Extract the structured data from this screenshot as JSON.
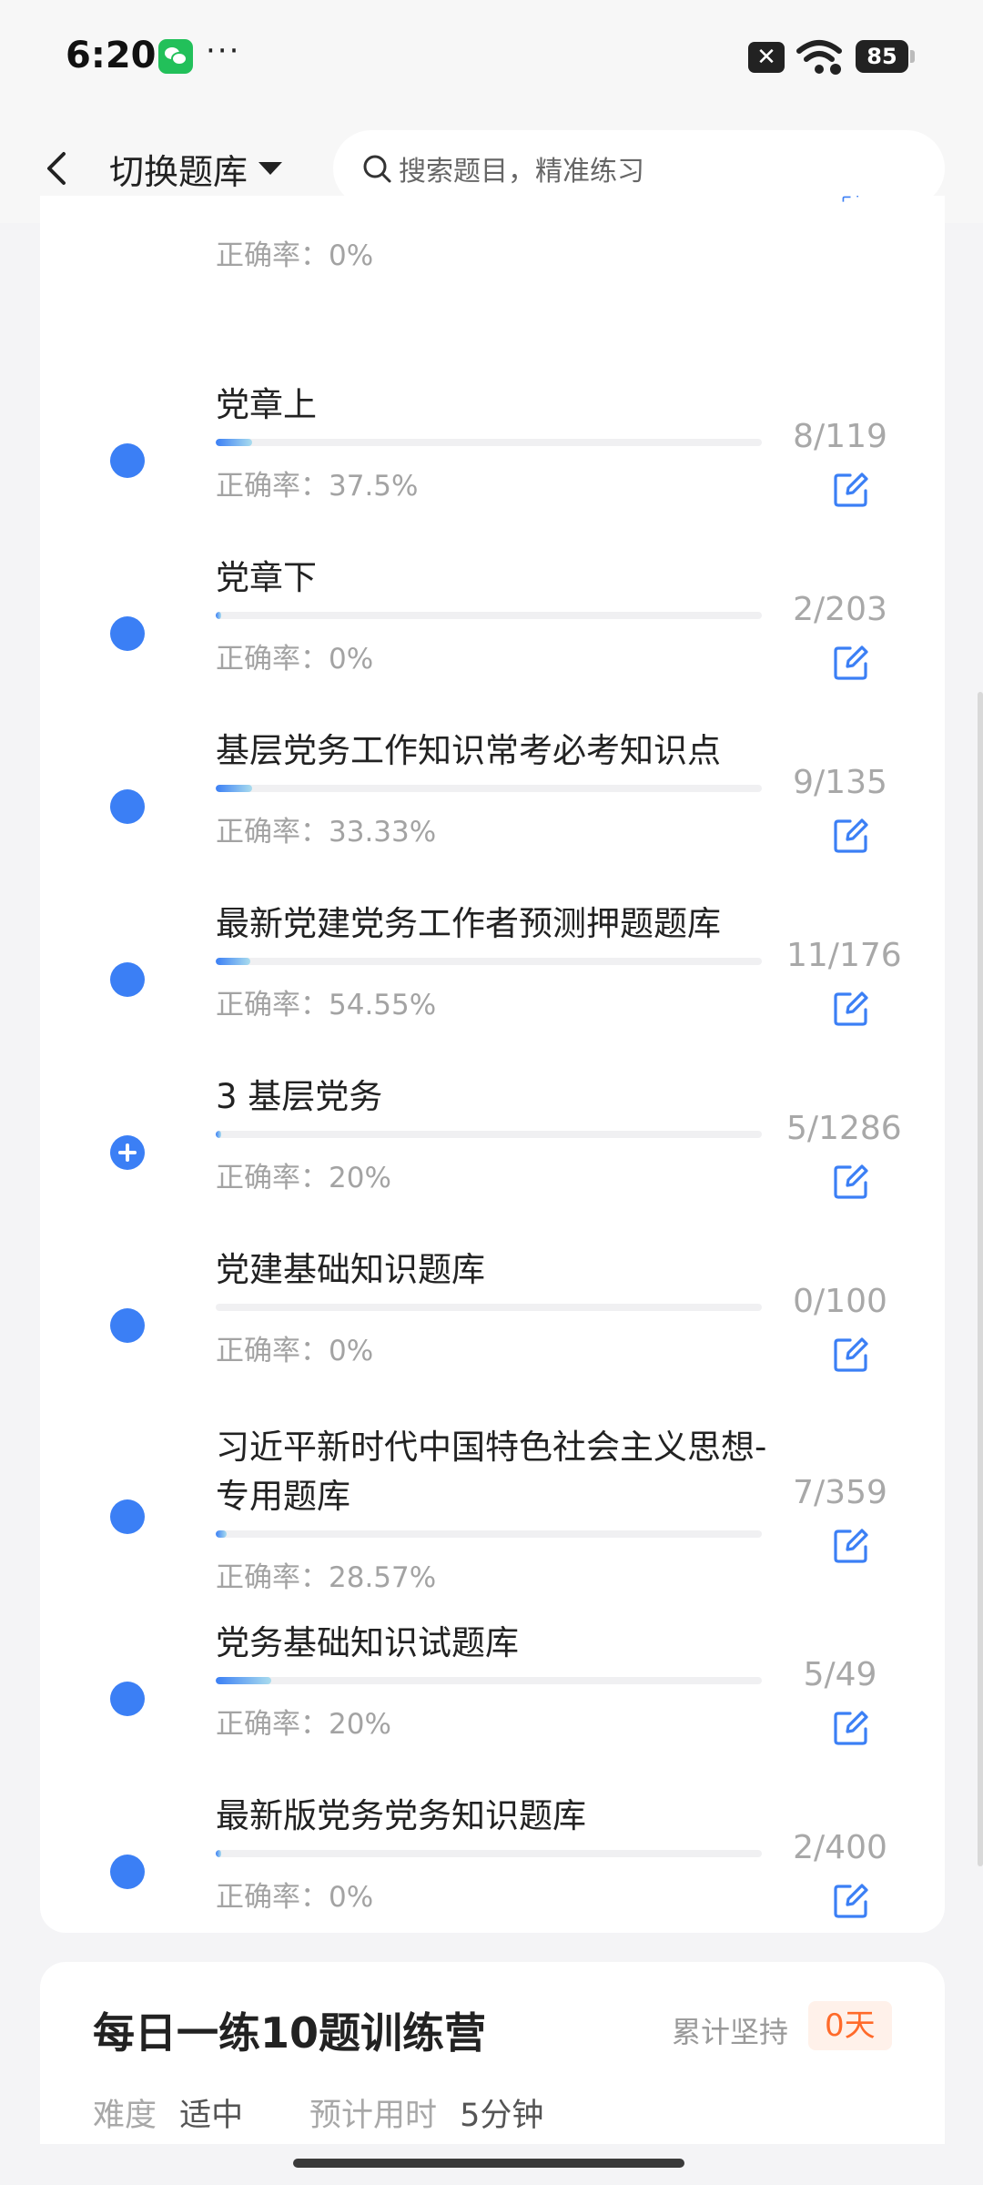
{
  "status_bar": {
    "time": "6:20",
    "dots": "···",
    "battery": "85",
    "icons": [
      "wechat-icon",
      "close-notification-icon",
      "wifi-icon",
      "battery-icon"
    ]
  },
  "header": {
    "switch_label": "切换题库",
    "search_placeholder": "搜索题目，精准练习"
  },
  "partial_row": {
    "accuracy": "正确率：0%"
  },
  "rows": [
    {
      "title": "党章上",
      "count": "8/119",
      "accuracy": "正确率：37.5%",
      "progress": 0.067,
      "icon": "dot"
    },
    {
      "title": "党章下",
      "count": "2/203",
      "accuracy": "正确率：0%",
      "progress": 0.01,
      "icon": "dot"
    },
    {
      "title": "基层党务工作知识常考必考知识点",
      "count": "9/135",
      "accuracy": "正确率：33.33%",
      "progress": 0.067,
      "icon": "dot"
    },
    {
      "title": "最新党建党务工作者预测押题题库",
      "count": "11/176",
      "accuracy": "正确率：54.55%",
      "progress": 0.0625,
      "icon": "dot"
    },
    {
      "title": "3 基层党务",
      "count": "5/1286",
      "accuracy": "正确率：20%",
      "progress": 0.004,
      "icon": "plus"
    },
    {
      "title": "党建基础知识题库",
      "count": "0/100",
      "accuracy": "正确率：0%",
      "progress": 0,
      "icon": "dot"
    },
    {
      "title": "习近平新时代中国特色社会主义思想-专用题库",
      "count": "7/359",
      "accuracy": "正确率：28.57%",
      "progress": 0.0195,
      "icon": "dot"
    },
    {
      "title": "党务基础知识试题库",
      "count": "5/49",
      "accuracy": "正确率：20%",
      "progress": 0.102,
      "icon": "dot"
    },
    {
      "title": "最新版党务党务知识题库",
      "count": "2/400",
      "accuracy": "正确率：0%",
      "progress": 0.005,
      "icon": "dot"
    }
  ],
  "daily": {
    "title": "每日一练10题训练营",
    "persist_label": "累计坚持",
    "days": "0天",
    "difficulty_label": "难度",
    "difficulty_value": "适中",
    "time_label": "预计用时",
    "time_value": "5分钟"
  },
  "colors": {
    "accent": "#3b7ff5",
    "bar_end": "#a9dcee",
    "days_text": "#ff6a2a"
  }
}
